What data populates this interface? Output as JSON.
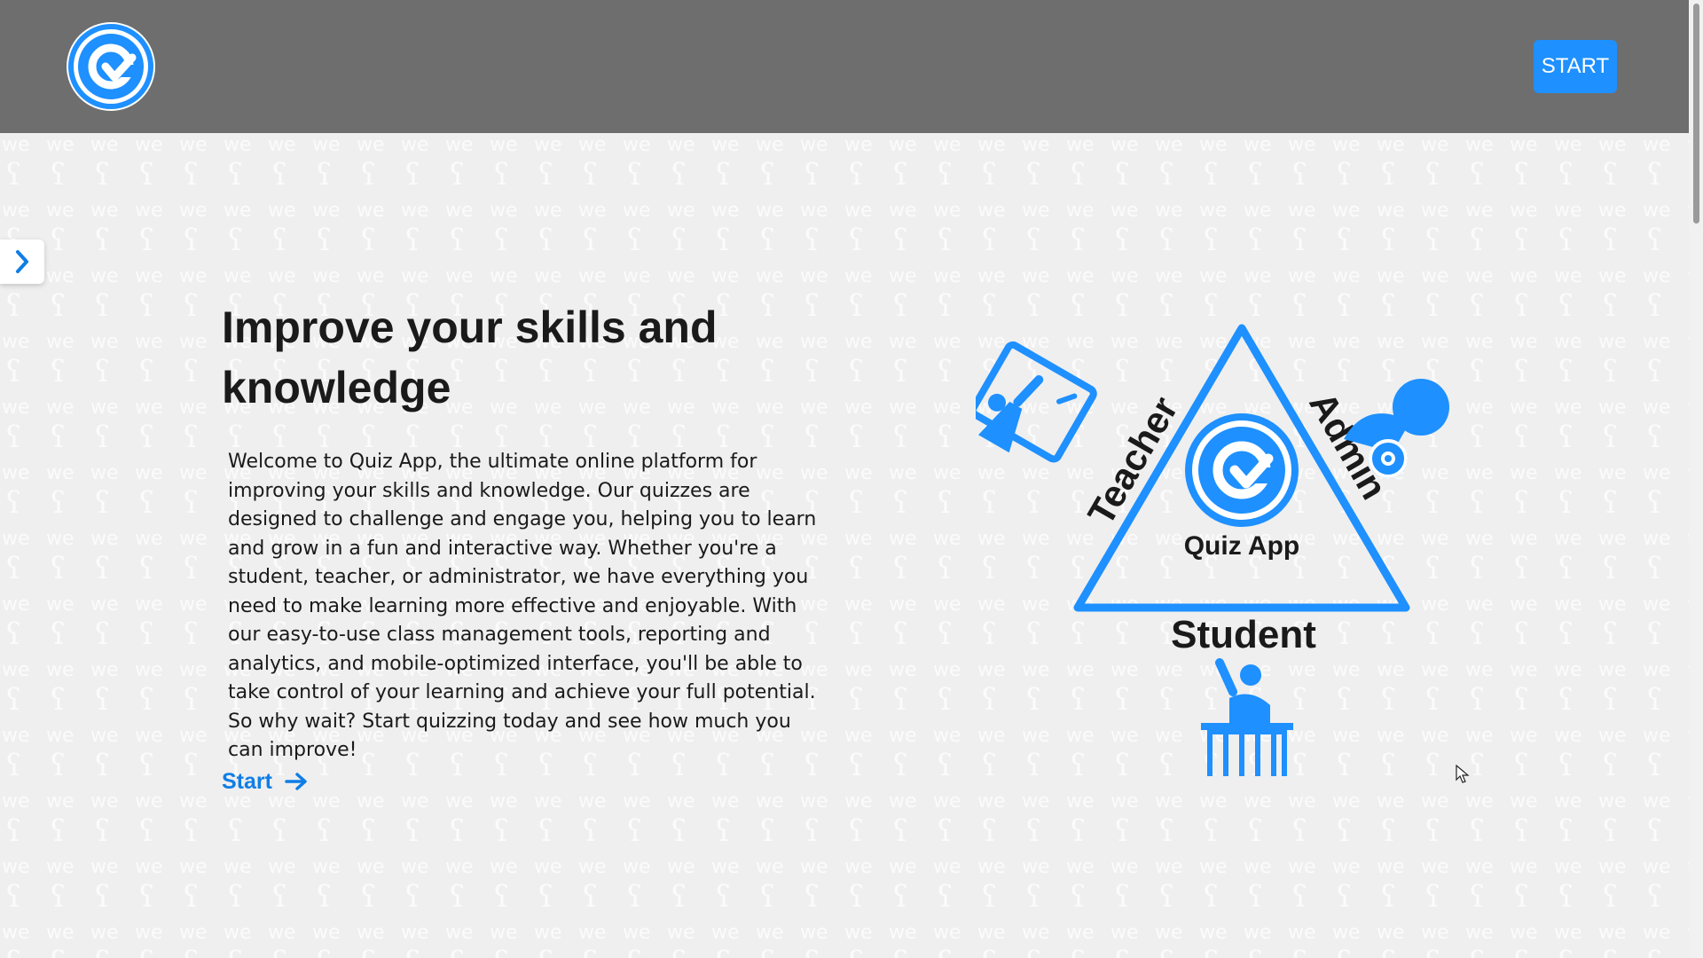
{
  "header": {
    "logo_icon": "quiz-app-logo-icon",
    "start_button_label": "START"
  },
  "sidebar_toggle": {
    "icon": "chevron-right-icon"
  },
  "hero": {
    "title": "Improve your skills and knowledge",
    "description": "Welcome to Quiz App, the ultimate online platform for improving your skills and knowledge. Our quizzes are designed to challenge and engage you, helping you to learn and grow in a fun and interactive way. Whether you're a student, teacher, or administrator, we have everything you need to make learning more effective and enjoyable. With our easy-to-use class management tools, reporting and analytics, and mobile-optimized interface, you'll be able to take control of your learning and achieve your full potential. So why wait? Start quizzing today and see how much you can improve!",
    "start_link_label": "Start",
    "start_link_icon": "arrow-right-icon"
  },
  "illustration": {
    "center_label": "Quiz App",
    "teacher_label": "Teacher",
    "admin_label": "Admin",
    "student_label": "Student"
  },
  "colors": {
    "accent": "#1e90ff",
    "header_bg": "#6e6e6e",
    "page_bg": "#efefef"
  }
}
